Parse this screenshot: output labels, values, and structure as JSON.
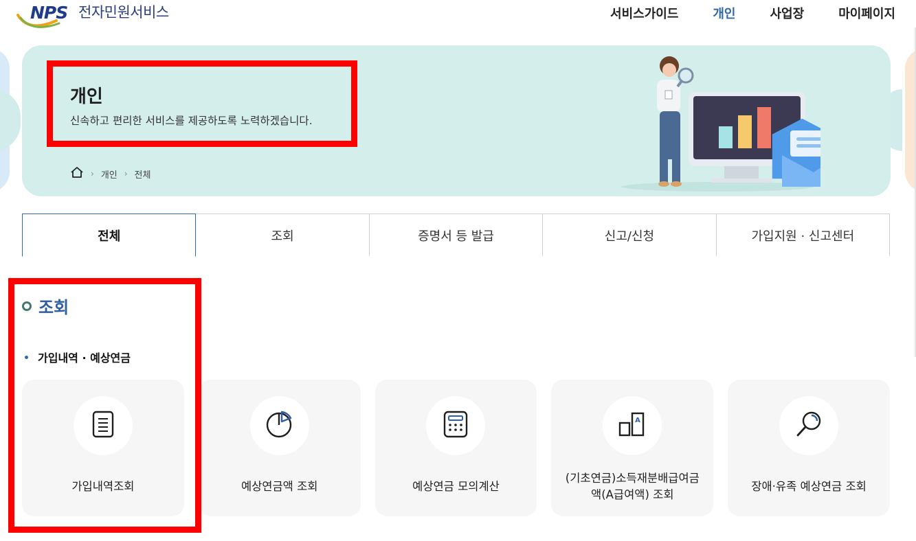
{
  "header": {
    "logo_mark": "NPS",
    "logo_text": "전자민원서비스",
    "nav": [
      "서비스가이드",
      "개인",
      "사업장",
      "마이페이지"
    ],
    "active_nav": "개인"
  },
  "banner": {
    "title": "개인",
    "description": "신속하고 편리한 서비스를 제공하도록 노력하겠습니다.",
    "breadcrumb": [
      "개인",
      "전체"
    ]
  },
  "tabs": [
    "전체",
    "조회",
    "증명서 등 발급",
    "신고/신청",
    "가입지원 · 신고센터"
  ],
  "active_tab": "전체",
  "section": {
    "title": "조회",
    "subtitle": "가입내역 · 예상연금",
    "cards": [
      {
        "label": "가입내역조회",
        "icon": "document-icon"
      },
      {
        "label": "예상연금액 조회",
        "icon": "pie-chart-icon"
      },
      {
        "label": "예상연금 모의계산",
        "icon": "calculator-icon"
      },
      {
        "label": "(기초연금)소득재분배급여금액(A급여액) 조회",
        "icon": "a-value-icon"
      },
      {
        "label": "장애·유족 예상연금 조회",
        "icon": "magnifier-icon"
      }
    ]
  },
  "colors": {
    "brand_blue": "#2f6aa8",
    "banner_bg": "#d4eeec",
    "highlight_red": "#ff0000",
    "card_bg": "#f6f6f6"
  }
}
